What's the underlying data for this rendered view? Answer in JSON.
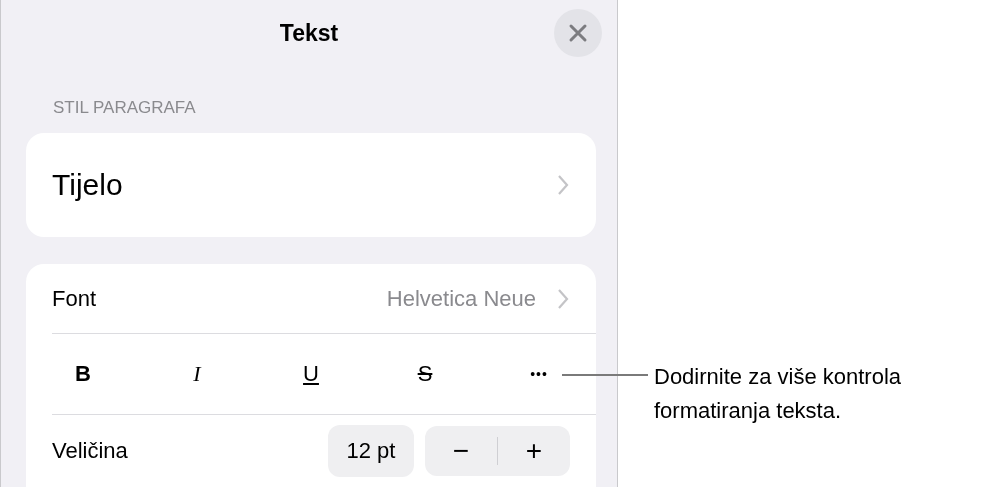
{
  "panel": {
    "title": "Tekst",
    "section_label": "STIL PARAGRAFA",
    "paragraph_style": "Tijelo",
    "font": {
      "label": "Font",
      "value": "Helvetica Neue"
    },
    "style_buttons": [
      {
        "kind": "bold",
        "label": "B"
      },
      {
        "kind": "italic",
        "label": "I"
      },
      {
        "kind": "underline",
        "label": "U"
      },
      {
        "kind": "strike",
        "label": "S"
      },
      {
        "kind": "more",
        "label": "•••"
      }
    ],
    "size": {
      "label": "Veličina",
      "value": "12 pt",
      "decrement": "−",
      "increment": "+"
    }
  },
  "callout": "Dodirnite za više kontrola formatiranja teksta."
}
